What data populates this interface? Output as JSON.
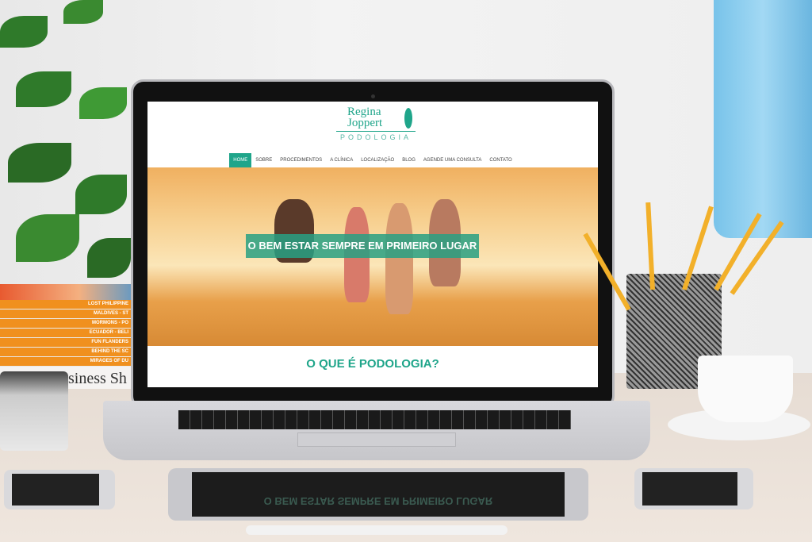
{
  "website": {
    "logo": {
      "line1": "Regina",
      "line2": "Joppert",
      "subtitle": "PODOLOGIA"
    },
    "nav": [
      {
        "label": "HOME",
        "active": true
      },
      {
        "label": "SOBRE"
      },
      {
        "label": "PROCEDIMENTOS",
        "has_dropdown": true
      },
      {
        "label": "A CLÍNICA"
      },
      {
        "label": "LOCALIZAÇÃO"
      },
      {
        "label": "BLOG"
      },
      {
        "label": "AGENDE UMA CONSULTA"
      },
      {
        "label": "CONTATO",
        "has_dropdown": true
      }
    ],
    "hero_banner": "O BEM ESTAR SEMPRE EM PRIMEIRO LUGAR",
    "section_title": "O QUE É PODOLOGIA?",
    "accent_color": "#1fa58a"
  },
  "scene": {
    "books": [
      "LOST PHILIPPINE",
      "MALDIVES - ST",
      "MORMONS - PO",
      "ECUADOR - BELI",
      "FUN FLANDERS",
      "BEHIND THE SC",
      "MIRAGES OF DU"
    ],
    "magazine": "siness Sh"
  }
}
